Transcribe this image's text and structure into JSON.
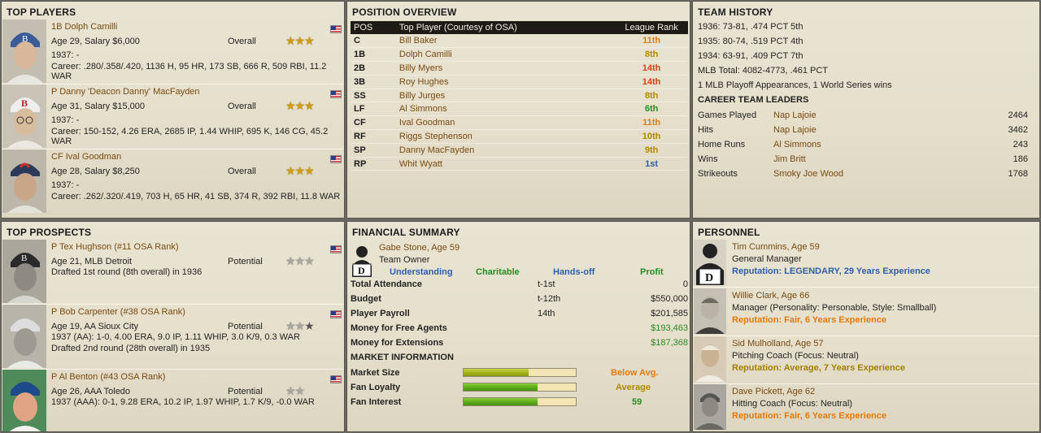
{
  "top_players": {
    "title": "TOP PLAYERS",
    "rating_label": "Overall",
    "players": [
      {
        "name": "1B Dolph Camilli",
        "info": "Age 29, Salary $6,000",
        "year_line": "1937: -",
        "career": "Career: .280/.358/.420, 1136 H, 95 HR, 173 SB, 666 R, 509 RBI, 11.2 WAR",
        "stars": "3 of 3"
      },
      {
        "name": "P Danny 'Deacon Danny' MacFayden",
        "info": "Age 31, Salary $15,000",
        "year_line": "1937: -",
        "career": "Career: 150-152, 4.26 ERA, 2685 IP, 1.44 WHIP, 695 K, 146 CG, 45.2 WAR",
        "stars": "3 of 3"
      },
      {
        "name": "CF Ival Goodman",
        "info": "Age 28, Salary $8,250",
        "year_line": "1937: -",
        "career": "Career: .262/.320/.419, 703 H, 65 HR, 41 SB, 374 R, 392 RBI, 11.8 WAR",
        "stars": "3 of 3"
      }
    ]
  },
  "position_overview": {
    "title": "POSITION OVERVIEW",
    "headers": {
      "pos": "POS",
      "player": "Top Player (Courtesy of OSA)",
      "rank": "League Rank"
    },
    "rows": [
      {
        "pos": "C",
        "player": "Bill Baker",
        "rank": "11th",
        "color": "#e07b10"
      },
      {
        "pos": "1B",
        "player": "Dolph Camilli",
        "rank": "8th",
        "color": "#b08a00"
      },
      {
        "pos": "2B",
        "player": "Billy Myers",
        "rank": "14th",
        "color": "#d2421a"
      },
      {
        "pos": "3B",
        "player": "Roy Hughes",
        "rank": "14th",
        "color": "#d2421a"
      },
      {
        "pos": "SS",
        "player": "Billy Jurges",
        "rank": "8th",
        "color": "#b08a00"
      },
      {
        "pos": "LF",
        "player": "Al Simmons",
        "rank": "6th",
        "color": "#2a8a23"
      },
      {
        "pos": "CF",
        "player": "Ival Goodman",
        "rank": "11th",
        "color": "#e07b10"
      },
      {
        "pos": "RF",
        "player": "Riggs Stephenson",
        "rank": "10th",
        "color": "#b08a00"
      },
      {
        "pos": "SP",
        "player": "Danny MacFayden",
        "rank": "9th",
        "color": "#b08a00"
      },
      {
        "pos": "RP",
        "player": "Whit Wyatt",
        "rank": "1st",
        "color": "#2f5ea8"
      }
    ]
  },
  "team_history": {
    "title": "TEAM HISTORY",
    "seasons": [
      "1936: 73-81, .474 PCT 5th",
      "1935: 80-74, .519 PCT 4th",
      "1934: 63-91, .409 PCT 7th"
    ],
    "mlb_total": "MLB Total: 4082-4773, .461 PCT",
    "playoffs": "1 MLB Playoff Appearances, 1 World Series wins",
    "leaders_title": "CAREER TEAM LEADERS",
    "leaders": [
      {
        "category": "Games Played",
        "name": "Nap Lajoie",
        "value": "2464"
      },
      {
        "category": "Hits",
        "name": "Nap Lajoie",
        "value": "3462"
      },
      {
        "category": "Home Runs",
        "name": "Al Simmons",
        "value": "243"
      },
      {
        "category": "Wins",
        "name": "Jim Britt",
        "value": "186"
      },
      {
        "category": "Strikeouts",
        "name": "Smoky Joe Wood",
        "value": "1768"
      }
    ]
  },
  "top_prospects": {
    "title": "TOP PROSPECTS",
    "rating_label": "Potential",
    "prospects": [
      {
        "name": "P Tex Hughson (#11 OSA Rank)",
        "info": "Age 21, MLB Detroit",
        "line2": "Drafted 1st round (8th overall) in 1936",
        "line3": "",
        "stars": "grey"
      },
      {
        "name": "P Bob Carpenter (#38 OSA Rank)",
        "info": "Age 19, AA Sioux City",
        "line2": "1937 (AA): 1-0, 4.00 ERA, 9.0 IP, 1.11 WHIP, 3.0 K/9, 0.3 WAR",
        "line3": "Drafted 2nd round (28th overall) in 1935",
        "stars": "grey"
      },
      {
        "name": "P Al Benton (#43 OSA Rank)",
        "info": "Age 26, AAA Toledo",
        "line2": "1937 (AAA): 0-1, 9.28 ERA, 10.2 IP, 1.97 WHIP, 1.7 K/9, -0.0 WAR",
        "line3": "",
        "stars": "grey"
      }
    ]
  },
  "financial_summary": {
    "title": "FINANCIAL SUMMARY",
    "owner_name": "Gabe Stone, Age 59",
    "owner_role": "Team Owner",
    "traits": [
      {
        "label": "Understanding",
        "color": "#2f5ea8"
      },
      {
        "label": "Charitable",
        "color": "#2a8a23"
      },
      {
        "label": "Hands-off",
        "color": "#2f5ea8"
      },
      {
        "label": "Profit",
        "color": "#2a8a23"
      }
    ],
    "rows": [
      {
        "label": "Total Attendance",
        "rank": "t-1st",
        "value": "0"
      },
      {
        "label": "Budget",
        "rank": "t-12th",
        "value": "$550,000"
      },
      {
        "label": "Player Payroll",
        "rank": "14th",
        "value": "$201,585"
      },
      {
        "label": "Money for Free Agents",
        "rank": "",
        "value": "$193,463"
      },
      {
        "label": "Money for Extensions",
        "rank": "",
        "value": "$187,368"
      }
    ],
    "market_title": "MARKET INFORMATION",
    "market": [
      {
        "label": "Market Size",
        "value": "Below Avg.",
        "fill": 0.58,
        "color": "#e07b10"
      },
      {
        "label": "Fan Loyalty",
        "value": "Average",
        "fill": 0.66,
        "color": "#b08a00"
      },
      {
        "label": "Fan Interest",
        "value": "59",
        "fill": 0.66,
        "color": "#2a8a23"
      }
    ]
  },
  "personnel": {
    "title": "PERSONNEL",
    "staff": [
      {
        "name": "Tim Cummins, Age 59",
        "role": "General Manager",
        "reputation": "Reputation: LEGENDARY, 29 Years Experience",
        "rep_class": "rep-blue"
      },
      {
        "name": "Willie Clark, Age 66",
        "role": "Manager (Personality: Personable, Style: Smallball)",
        "reputation": "Reputation: Fair, 6 Years Experience",
        "rep_class": "rep-orange"
      },
      {
        "name": "Sid Mulholland, Age 57",
        "role": "Pitching Coach (Focus: Neutral)",
        "reputation": "Reputation: Average, 7 Years Experience",
        "rep_class": "rep-olive"
      },
      {
        "name": "Dave Pickett, Age 62",
        "role": "Hitting Coach (Focus: Neutral)",
        "reputation": "Reputation: Fair, 6 Years Experience",
        "rep_class": "rep-orange"
      }
    ]
  }
}
